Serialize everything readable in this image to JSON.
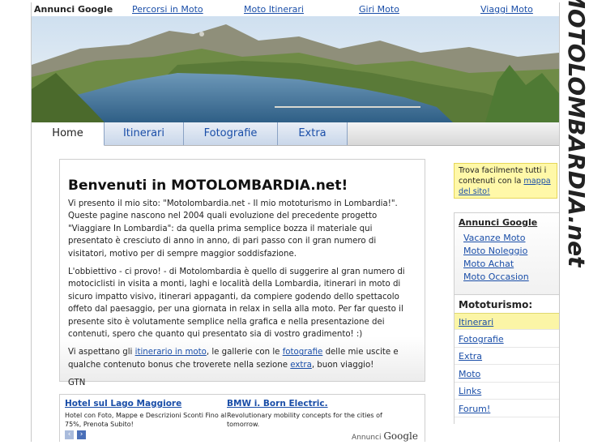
{
  "adlinks": {
    "label": "Annunci Google",
    "links": [
      "Percorsi in Moto",
      "Moto Itinerari",
      "Giri Moto",
      "Viaggi Moto"
    ]
  },
  "brand": {
    "text": "MOTOLOMBARDIA.net"
  },
  "nav": {
    "tabs": [
      "Home",
      "Itinerari",
      "Fotografie",
      "Extra"
    ],
    "active": "Home"
  },
  "content": {
    "title": "Benvenuti in MOTOLOMBARDIA.net!",
    "p1": "Vi presento il mio sito: \"Motolombardia.net - Il mio mototurismo in Lombardia!\". Queste pagine nascono nel 2004 quali evoluzione del precedente progetto \"Viaggiare In Lombardia\": da quella prima semplice bozza il materiale qui presentato è cresciuto di anno in anno, di pari passo con il gran numero di visitatori, motivo per di sempre maggior soddisfazione.",
    "p2": "L'obbiettivo - ci provo! - di Motolombardia è quello di suggerire al gran numero di motociclisti in visita a monti, laghi e località della Lombardia, itinerari in moto di sicuro impatto visivo, itinerari appaganti, da compiere godendo dello spettacolo offeto dal paesaggio, per una giornata in relax in sella alla moto. Per far questo il presente sito è volutamente semplice nella grafica e nella presentazione dei contenuti, spero che quanto qui presentato sia di vostro gradimento! :)",
    "p3_a": "Vi aspettano gli ",
    "p3_link1": "itinerario in moto",
    "p3_b": ", le gallerie con le ",
    "p3_link2": "fotografie",
    "p3_c": " delle mie uscite e qualche contenuto bonus che troverete nella sezione ",
    "p3_link3": "extra",
    "p3_d": ", buon viaggio!",
    "sign": "GTN"
  },
  "gad": {
    "ad1_title": "Hotel sul Lago Maggiore",
    "ad1_desc": "Hotel con Foto, Mappe e Descrizioni Sconti Fino al 75%, Prenota Subito!",
    "ad2_title": "BMW i. Born Electric.",
    "ad2_desc": "Revolutionary mobility concepts for the cities of tomorrow.",
    "footer_a": "Annunci",
    "footer_b": "Google"
  },
  "note": {
    "text": "Trova facilmente tutti i contenuti con la ",
    "link": "mappa del sito!"
  },
  "side_google": {
    "label": "Annunci Google",
    "links": [
      "Vacanze Moto",
      "Moto Noleggio",
      "Moto Achat",
      "Moto Occasion"
    ]
  },
  "mototurismo": {
    "label": "Mototurismo:",
    "items": [
      "Itinerari",
      "Fotografie",
      "Extra",
      "Moto",
      "Links",
      "Forum!"
    ],
    "highlighted": "Itinerari"
  },
  "colors": {
    "link": "#1a4ea8",
    "note_bg": "#fff8a8",
    "nav_tab": "#c9d7ea"
  }
}
